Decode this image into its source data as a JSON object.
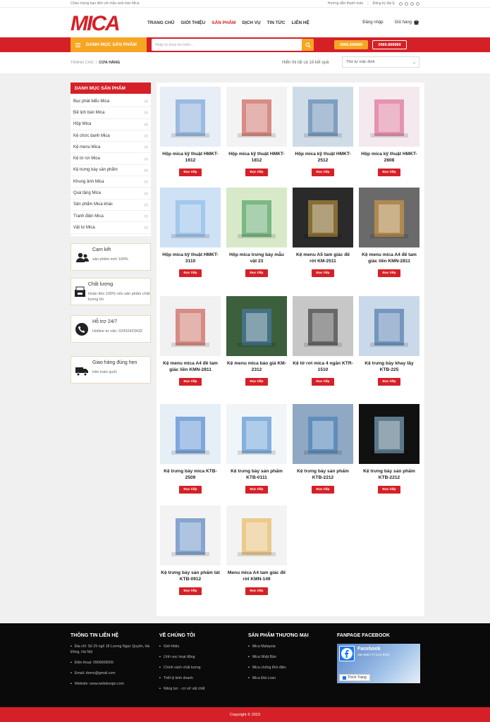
{
  "topbar": {
    "welcome": "Chào mừng bạn đến với mẫu web bán Mica",
    "payment_guide": "Hướng dẫn thanh toán",
    "sell_register": "Đăng ký đại lý"
  },
  "logo": {
    "text": "MICA"
  },
  "nav": {
    "items": [
      "TRANG CHỦ",
      "GIỚI THIỆU",
      "SẢN PHẨM",
      "DỊCH VỤ",
      "TIN TỨC",
      "LIÊN HỆ"
    ],
    "login": "Đăng nhập",
    "cart": "Giỏ hàng"
  },
  "redbar": {
    "category_label": "DANH MỤC SẢN PHẨM",
    "search_placeholder": "Nhập từ khóa tìm kiếm...",
    "phone1": "0989.898989",
    "phone2": "0989.898989"
  },
  "breadcrumb": {
    "home": "TRANG CHỦ",
    "sep": "/",
    "current": "CỬA HÀNG"
  },
  "result_text": "Hiển thị tất cả 18 kết quả",
  "sort_label": "Thứ tự mặc định",
  "sidebar": {
    "title": "DANH MỤC SẢN PHẨM",
    "items": [
      {
        "label": "Bục phát biểu Mica",
        "count": "(2)"
      },
      {
        "label": "Đế lịch bàn Mica",
        "count": "(2)"
      },
      {
        "label": "Hộp Mica",
        "count": "(6)"
      },
      {
        "label": "Kệ chức danh Mica",
        "count": "(2)"
      },
      {
        "label": "Kệ menu Mica",
        "count": "(3)"
      },
      {
        "label": "Kệ tờ rơi Mica",
        "count": "(2)"
      },
      {
        "label": "Kệ trưng bày sản phẩm",
        "count": "(6)"
      },
      {
        "label": "Khung ảnh Mica",
        "count": "(2)"
      },
      {
        "label": "Quà tặng Mica",
        "count": "(2)"
      },
      {
        "label": "Sản phẩm Mica khác",
        "count": "(2)"
      },
      {
        "label": "Tranh điện Mica",
        "count": "(2)"
      },
      {
        "label": "Vật tư Mica",
        "count": "(2)"
      }
    ]
  },
  "features": [
    {
      "title": "Cam kết",
      "desc": "sản phẩm mới 100%",
      "icon": "people-icon"
    },
    {
      "title": "Chất lượng",
      "desc": "Hoàn tiền 100% nếu sản phẩm chất lượng tồi",
      "icon": "register-icon"
    },
    {
      "title": "Hỗ trợ 24/7",
      "desc": "Hotline tư vấn: 02432423432",
      "icon": "phone-icon"
    },
    {
      "title": "Giao hàng đúng hẹn",
      "desc": "trên toàn quốc",
      "icon": "truck-icon"
    }
  ],
  "products": [
    {
      "name": "Hộp mica kỹ thuật HMKT-1612",
      "btn": "Đọc tiếp"
    },
    {
      "name": "Hộp mica kỹ thuật HMKT-1812",
      "btn": "Đọc tiếp"
    },
    {
      "name": "Hộp mica kỹ thuật HMKT-2512",
      "btn": "Đọc tiếp"
    },
    {
      "name": "Hộp mica kỹ thuật HMKT-2808",
      "btn": "Đọc tiếp"
    },
    {
      "name": "Hộp mica kỹ thuật HMKT-3110",
      "btn": "Đọc tiếp"
    },
    {
      "name": "Hộp mica trưng bày mẫu vật 23",
      "btn": "Đọc tiếp"
    },
    {
      "name": "Kệ menu A5 tam giác đế rời KM-2511",
      "btn": "Đọc tiếp"
    },
    {
      "name": "Kệ menu mica A4 đế tam giác liền KMN-2811",
      "btn": "Đọc tiếp"
    },
    {
      "name": "Kệ menu mica A4 đế tam giác liền KMN-2811",
      "btn": "Đọc tiếp"
    },
    {
      "name": "Kệ menu mica báo giá KM-2312",
      "btn": "Đọc tiếp"
    },
    {
      "name": "Kệ tờ rơi mica 4 ngăn KTR-1510",
      "btn": "Đọc tiếp"
    },
    {
      "name": "Kệ trưng bày khay tầy KTB-225",
      "btn": "Đọc tiếp"
    },
    {
      "name": "Kệ trưng bày mica KTB-2509",
      "btn": "Đọc tiếp"
    },
    {
      "name": "Kệ trưng bày sản phẩm KTB-0111",
      "btn": "Đọc tiếp"
    },
    {
      "name": "Kệ trưng bày sản phẩm KTB-2212",
      "btn": "Đọc tiếp"
    },
    {
      "name": "Kệ trưng bày sản phẩm KTB-2212",
      "btn": "Đọc tiếp"
    },
    {
      "name": "Kệ trưng bày sản phẩm tát KTB-0912",
      "btn": "Đọc tiếp"
    },
    {
      "name": "Menu mica A4 tam giác đế rời KMN-149",
      "btn": "Đọc tiếp"
    }
  ],
  "footer": {
    "contact_title": "THÔNG TIN LIÊN HỆ",
    "contact": [
      "Địa chỉ: Số 29 ngõ 18 Lương Ngọc Quyến, Hà Đông, Hà Nội",
      "Điện thoại: 0909009009",
      "Email: demo@gmail.com",
      "Website: www.webdesign.com"
    ],
    "about_title": "VỀ CHÚNG TÔI",
    "about": [
      "Giới thiệu",
      "Lĩnh vực hoạt động",
      "Chính sách chất lượng",
      "Triết lý kinh doanh",
      "Năng lực - cơ sở vật chất"
    ],
    "brand_title": "SẢN PHẨM THƯƠNG MẠI",
    "brands": [
      "Mica Malaysia",
      "Mica Nhật Bản",
      "Mica chống tĩnh điện",
      "Mica Đài Loan"
    ],
    "fanpage_title": "FANPAGE FACEBOOK",
    "fb_name": "Facebook",
    "fb_likes": "182.686.777 lượt thích",
    "fb_like_btn": "Thích Trang"
  },
  "copyright": "Copyright © 2023",
  "colors": {
    "brand_red": "#d62027",
    "accent_orange": "#f6a623"
  }
}
